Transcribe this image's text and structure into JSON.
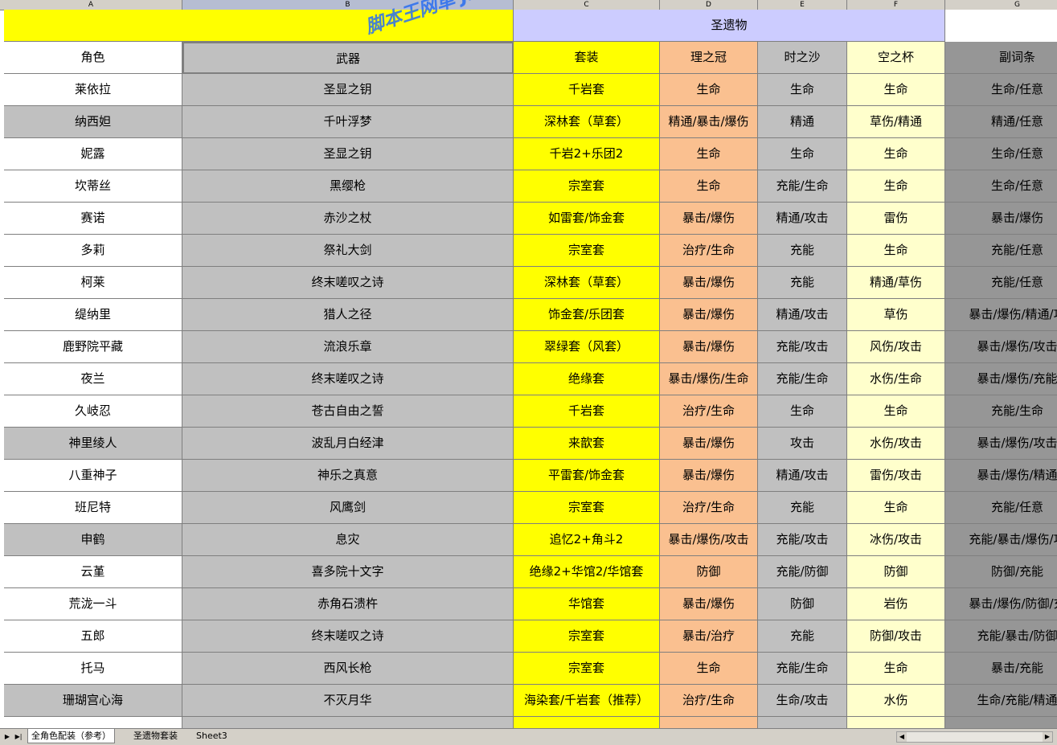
{
  "columns": [
    "A",
    "B",
    "C",
    "D",
    "E",
    "F",
    "G"
  ],
  "title_row": {
    "relic_group": "圣遗物"
  },
  "headers": {
    "role": "角色",
    "weapon": "武器",
    "set": "套装",
    "circlet": "理之冠",
    "sands": "时之沙",
    "goblet": "空之杯",
    "substats": "副词条"
  },
  "rows": [
    {
      "role": "莱依拉",
      "weapon": "圣显之钥",
      "set": "千岩套",
      "circlet": "生命",
      "sands": "生命",
      "goblet": "生命",
      "substats": "生命/任意",
      "shade": "white"
    },
    {
      "role": "纳西妲",
      "weapon": "千叶浮梦",
      "set": "深林套（草套）",
      "circlet": "精通/暴击/爆伤",
      "sands": "精通",
      "goblet": "草伤/精通",
      "substats": "精通/任意",
      "shade": "gray"
    },
    {
      "role": "妮露",
      "weapon": "圣显之钥",
      "set": "千岩2+乐团2",
      "circlet": "生命",
      "sands": "生命",
      "goblet": "生命",
      "substats": "生命/任意",
      "shade": "white"
    },
    {
      "role": "坎蒂丝",
      "weapon": "黑缨枪",
      "set": "宗室套",
      "circlet": "生命",
      "sands": "充能/生命",
      "goblet": "生命",
      "substats": "生命/任意",
      "shade": "white"
    },
    {
      "role": "赛诺",
      "weapon": "赤沙之杖",
      "set": "如雷套/饰金套",
      "circlet": "暴击/爆伤",
      "sands": "精通/攻击",
      "goblet": "雷伤",
      "substats": "暴击/爆伤",
      "shade": "white"
    },
    {
      "role": "多莉",
      "weapon": "祭礼大剑",
      "set": "宗室套",
      "circlet": "治疗/生命",
      "sands": "充能",
      "goblet": "生命",
      "substats": "充能/任意",
      "shade": "white"
    },
    {
      "role": "柯莱",
      "weapon": "终末嗟叹之诗",
      "set": "深林套（草套）",
      "circlet": "暴击/爆伤",
      "sands": "充能",
      "goblet": "精通/草伤",
      "substats": "充能/任意",
      "shade": "white"
    },
    {
      "role": "缇纳里",
      "weapon": "猎人之径",
      "set": "饰金套/乐团套",
      "circlet": "暴击/爆伤",
      "sands": "精通/攻击",
      "goblet": "草伤",
      "substats": "暴击/爆伤/精通/攻",
      "shade": "white"
    },
    {
      "role": "鹿野院平藏",
      "weapon": "流浪乐章",
      "set": "翠绿套（风套）",
      "circlet": "暴击/爆伤",
      "sands": "充能/攻击",
      "goblet": "风伤/攻击",
      "substats": "暴击/爆伤/攻击",
      "shade": "white"
    },
    {
      "role": "夜兰",
      "weapon": "终末嗟叹之诗",
      "set": "绝缘套",
      "circlet": "暴击/爆伤/生命",
      "sands": "充能/生命",
      "goblet": "水伤/生命",
      "substats": "暴击/爆伤/充能",
      "shade": "white"
    },
    {
      "role": "久岐忍",
      "weapon": "苍古自由之誓",
      "set": "千岩套",
      "circlet": "治疗/生命",
      "sands": "生命",
      "goblet": "生命",
      "substats": "充能/生命",
      "shade": "white"
    },
    {
      "role": "神里绫人",
      "weapon": "波乱月白经津",
      "set": "来歆套",
      "circlet": "暴击/爆伤",
      "sands": "攻击",
      "goblet": "水伤/攻击",
      "substats": "暴击/爆伤/攻击",
      "shade": "gray"
    },
    {
      "role": "八重神子",
      "weapon": "神乐之真意",
      "set": "平雷套/饰金套",
      "circlet": "暴击/爆伤",
      "sands": "精通/攻击",
      "goblet": "雷伤/攻击",
      "substats": "暴击/爆伤/精通",
      "shade": "white"
    },
    {
      "role": "班尼特",
      "weapon": "风鹰剑",
      "set": "宗室套",
      "circlet": "治疗/生命",
      "sands": "充能",
      "goblet": "生命",
      "substats": "充能/任意",
      "shade": "white"
    },
    {
      "role": "申鹤",
      "weapon": "息灾",
      "set": "追忆2+角斗2",
      "circlet": "暴击/爆伤/攻击",
      "sands": "充能/攻击",
      "goblet": "冰伤/攻击",
      "substats": "充能/暴击/爆伤/攻",
      "shade": "gray"
    },
    {
      "role": "云堇",
      "weapon": "喜多院十文字",
      "set": "绝缘2+华馆2/华馆套",
      "circlet": "防御",
      "sands": "充能/防御",
      "goblet": "防御",
      "substats": "防御/充能",
      "shade": "white"
    },
    {
      "role": "荒泷一斗",
      "weapon": "赤角石溃杵",
      "set": "华馆套",
      "circlet": "暴击/爆伤",
      "sands": "防御",
      "goblet": "岩伤",
      "substats": "暴击/爆伤/防御/充",
      "shade": "white"
    },
    {
      "role": "五郎",
      "weapon": "终末嗟叹之诗",
      "set": "宗室套",
      "circlet": "暴击/治疗",
      "sands": "充能",
      "goblet": "防御/攻击",
      "substats": "充能/暴击/防御",
      "shade": "white"
    },
    {
      "role": "托马",
      "weapon": "西风长枪",
      "set": "宗室套",
      "circlet": "生命",
      "sands": "充能/生命",
      "goblet": "生命",
      "substats": "暴击/充能",
      "shade": "white"
    },
    {
      "role": "珊瑚宫心海",
      "weapon": "不灭月华",
      "set": "海染套/千岩套（推荐）",
      "circlet": "治疗/生命",
      "sands": "生命/攻击",
      "goblet": "水伤",
      "substats": "生命/充能/精通",
      "shade": "gray"
    },
    {
      "role": "",
      "weapon": "",
      "set": "",
      "circlet": "",
      "sands": "",
      "goblet": "",
      "substats": "",
      "shade": "white"
    }
  ],
  "watermark": "脚本王网单 JiaoBenWang.Com",
  "sheet_tabs": [
    "全角色配装（参考）",
    "圣遗物套装",
    "Sheet3"
  ],
  "active_tab": 0,
  "colors": {
    "yellow": "#ffff00",
    "peach": "#fac090",
    "lavender": "#ccccff",
    "cream": "#ffffcc",
    "gray": "#c0c0c0",
    "dark_gray": "#969696",
    "watermark": "#2a6ef0"
  }
}
